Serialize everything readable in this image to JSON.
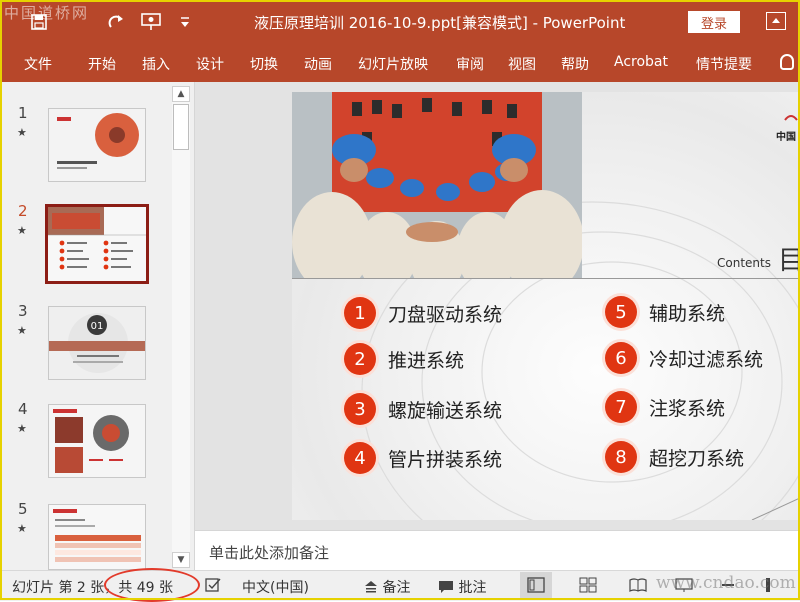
{
  "window": {
    "title": "液压原理培训 2016-10-9.ppt[兼容模式]  -  PowerPoint",
    "login_label": "登录",
    "watermark_top": "中国道桥网",
    "watermark_bottom": "www.cndao.com"
  },
  "quick_access": [
    {
      "icon": "save-icon"
    },
    {
      "icon": "redo-icon"
    },
    {
      "icon": "present-icon"
    },
    {
      "icon": "customize-qat-icon"
    }
  ],
  "menu": [
    "文件",
    "开始",
    "插入",
    "设计",
    "切换",
    "动画",
    "幻灯片放映",
    "审阅",
    "视图",
    "帮助",
    "Acrobat",
    "情节提要"
  ],
  "thumbnails": [
    {
      "number": "1",
      "star": "★"
    },
    {
      "number": "2",
      "star": "★"
    },
    {
      "number": "3",
      "star": "★"
    },
    {
      "number": "4",
      "star": "★"
    },
    {
      "number": "5",
      "star": "★"
    }
  ],
  "active_slide": 2,
  "slide": {
    "contents_label": "Contents",
    "title_char": "目",
    "company_text": "中国",
    "toc": [
      {
        "num": "1",
        "label": "刀盘驱动系统"
      },
      {
        "num": "2",
        "label": "推进系统"
      },
      {
        "num": "3",
        "label": "螺旋输送系统"
      },
      {
        "num": "4",
        "label": "管片拼装系统"
      },
      {
        "num": "5",
        "label": "辅助系统"
      },
      {
        "num": "6",
        "label": "冷却过滤系统"
      },
      {
        "num": "7",
        "label": "注浆系统"
      },
      {
        "num": "8",
        "label": "超挖刀系统"
      }
    ]
  },
  "notes_placeholder": "单击此处添加备注",
  "status": {
    "slide_info_a": "幻灯片 第 2 张",
    "slide_info_b": "，共 49 张",
    "language": "中文(中国)",
    "notes": "备注",
    "comments": "批注"
  },
  "colors": {
    "accent": "#b7472a",
    "toc_circle": "#e03512",
    "selected_border": "#8c1d15",
    "highlight_ring": "#e23b2b"
  }
}
